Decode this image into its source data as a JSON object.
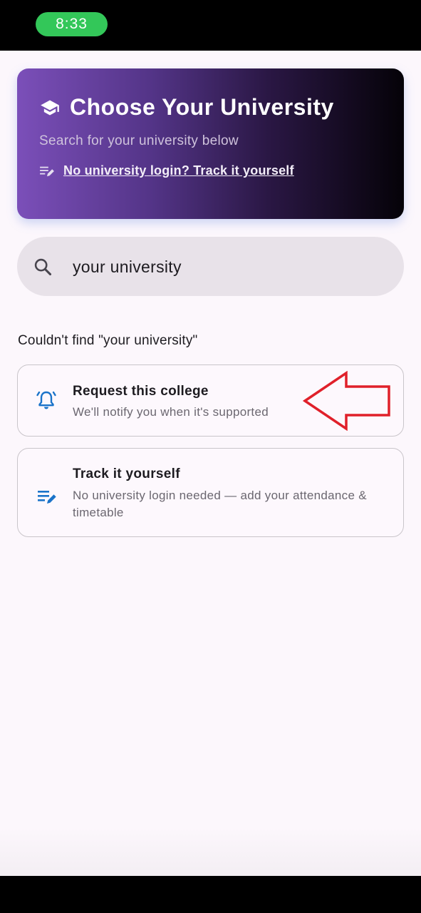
{
  "status_bar": {
    "time": "8:33"
  },
  "header": {
    "title": "Choose Your University",
    "subtitle": "Search for your university below",
    "manual_link": "No university login? Track it yourself"
  },
  "search": {
    "value": "your university"
  },
  "results": {
    "not_found_text": "Couldn't find \"your university\""
  },
  "options": {
    "request": {
      "title": "Request this college",
      "description": "We'll notify you when it's supported",
      "icon": "bell-ring-icon"
    },
    "track": {
      "title": "Track it yourself",
      "description": "No university login needed — add your attendance & timetable",
      "icon": "edit-notes-icon"
    }
  },
  "colors": {
    "accent": "#1a73c9",
    "header_gradient_start": "#7b4fb9",
    "header_gradient_end": "#050208",
    "status_pill": "#33c759",
    "annotation_arrow": "#e0202a"
  }
}
